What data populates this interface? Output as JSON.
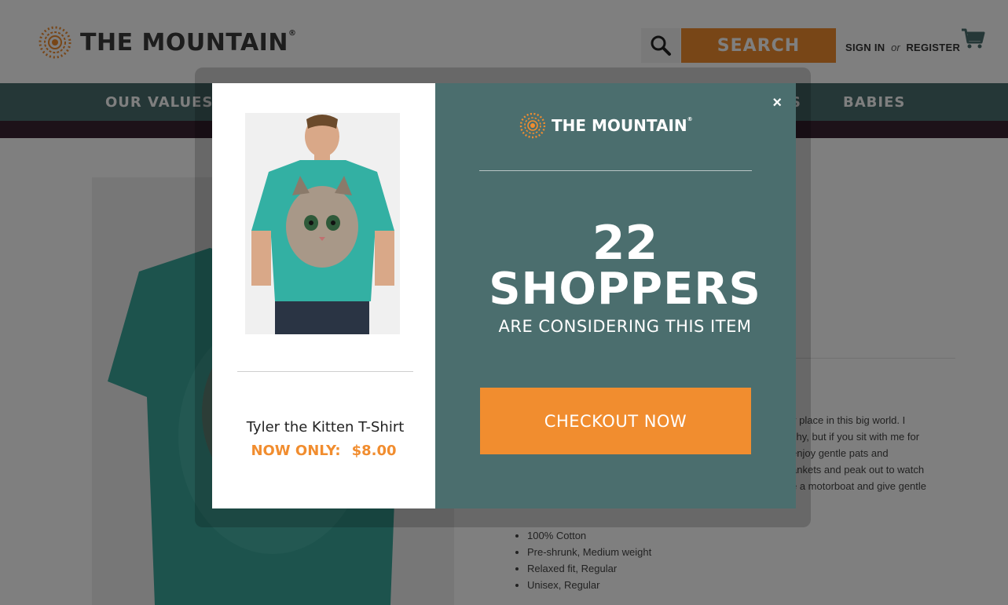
{
  "header": {
    "logo_text": "THE MOUNTAIN",
    "logo_mark": "®",
    "search_label": "SEARCH",
    "sign_in": "SIGN IN",
    "or": "or",
    "register": "REGISTER"
  },
  "nav": {
    "items": [
      "OUR VALUES",
      "S",
      "BABIES"
    ]
  },
  "content": {
    "description_fragments": [
      "y place in this big world. I",
      "shy, but if you sit with me for",
      "enjoy gentle pats and",
      "ankets and peak out to watch",
      "e a motorboat and give gentle"
    ],
    "specs": [
      "100% Cotton",
      "Pre-shrunk, Medium weight",
      "Relaxed fit, Regular",
      "Unisex, Regular"
    ]
  },
  "modal": {
    "close": "×",
    "logo_text": "THE MOUNTAIN",
    "logo_mark": "®",
    "shoppers_count": "22",
    "shoppers_word": "SHOPPERS",
    "considering": "ARE CONSIDERING THIS ITEM",
    "checkout_label": "CHECKOUT NOW",
    "product_name": "Tyler the Kitten T-Shirt",
    "now_only": "NOW ONLY:",
    "price": "$8.00"
  },
  "colors": {
    "accent_orange": "#f18d2f",
    "teal": "#4b6e6e",
    "promo_bar": "#3b2433"
  }
}
